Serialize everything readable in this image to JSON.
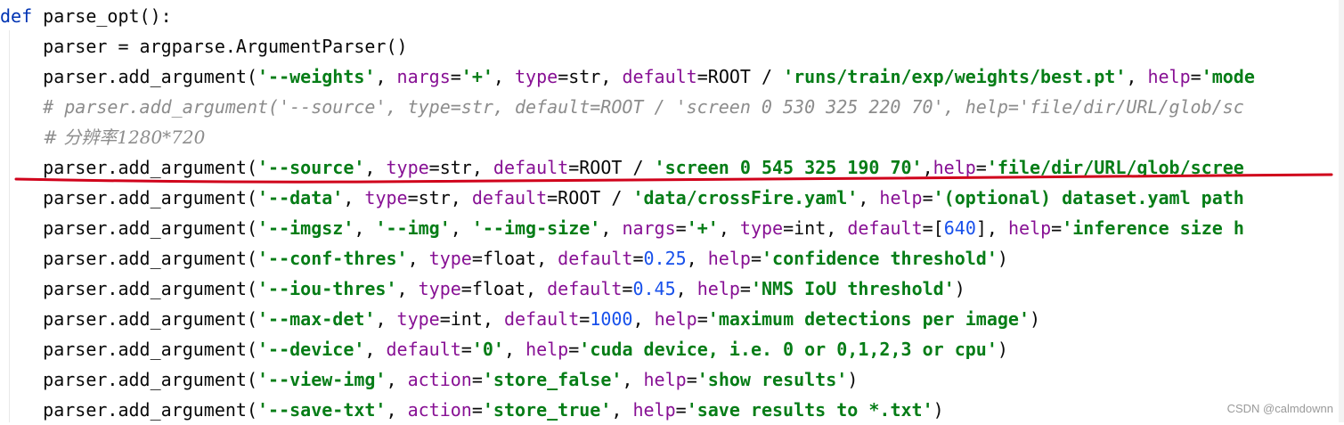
{
  "lines": [
    [
      {
        "t": "def",
        "c": "kw"
      },
      {
        "t": " parse_opt():"
      }
    ],
    [
      {
        "t": "    parser = argparse.ArgumentParser()"
      }
    ],
    [
      {
        "t": "    parser.add_argument("
      },
      {
        "t": "'--weights'",
        "c": "str"
      },
      {
        "t": ", "
      },
      {
        "t": "nargs",
        "c": "named"
      },
      {
        "t": "="
      },
      {
        "t": "'+'",
        "c": "str"
      },
      {
        "t": ", "
      },
      {
        "t": "type",
        "c": "named"
      },
      {
        "t": "=str, "
      },
      {
        "t": "default",
        "c": "named"
      },
      {
        "t": "=ROOT / "
      },
      {
        "t": "'runs/train/exp/weights/best.pt'",
        "c": "str"
      },
      {
        "t": ", "
      },
      {
        "t": "help",
        "c": "named"
      },
      {
        "t": "="
      },
      {
        "t": "'mode",
        "c": "str"
      }
    ],
    [
      {
        "t": "    "
      },
      {
        "t": "# parser.add_argument('--source', type=str, default=ROOT / 'screen 0 530 325 220 70', help='file/dir/URL/glob/sc",
        "c": "cmt"
      }
    ],
    [
      {
        "t": "    "
      },
      {
        "t": "# 分辨率1280*720",
        "c": "cmt"
      }
    ],
    [
      {
        "t": "    parser.add_argument("
      },
      {
        "t": "'--source'",
        "c": "str"
      },
      {
        "t": ", "
      },
      {
        "t": "type",
        "c": "named"
      },
      {
        "t": "=str, "
      },
      {
        "t": "default",
        "c": "named"
      },
      {
        "t": "=ROOT / "
      },
      {
        "t": "'screen 0 545 325 190 70'",
        "c": "str"
      },
      {
        "t": ","
      },
      {
        "t": "help",
        "c": "named"
      },
      {
        "t": "="
      },
      {
        "t": "'file/dir/URL/glob/scree",
        "c": "str"
      }
    ],
    [
      {
        "t": "    parser.add_argument("
      },
      {
        "t": "'--data'",
        "c": "str"
      },
      {
        "t": ", "
      },
      {
        "t": "type",
        "c": "named"
      },
      {
        "t": "=str, "
      },
      {
        "t": "default",
        "c": "named"
      },
      {
        "t": "=ROOT / "
      },
      {
        "t": "'data/crossFire.yaml'",
        "c": "str"
      },
      {
        "t": ", "
      },
      {
        "t": "help",
        "c": "named"
      },
      {
        "t": "="
      },
      {
        "t": "'(optional) dataset.yaml path",
        "c": "str"
      }
    ],
    [
      {
        "t": "    parser.add_argument("
      },
      {
        "t": "'--imgsz'",
        "c": "str"
      },
      {
        "t": ", "
      },
      {
        "t": "'--img'",
        "c": "str"
      },
      {
        "t": ", "
      },
      {
        "t": "'--img-size'",
        "c": "str"
      },
      {
        "t": ", "
      },
      {
        "t": "nargs",
        "c": "named"
      },
      {
        "t": "="
      },
      {
        "t": "'+'",
        "c": "str"
      },
      {
        "t": ", "
      },
      {
        "t": "type",
        "c": "named"
      },
      {
        "t": "=int, "
      },
      {
        "t": "default",
        "c": "named"
      },
      {
        "t": "=["
      },
      {
        "t": "640",
        "c": "num"
      },
      {
        "t": "], "
      },
      {
        "t": "help",
        "c": "named"
      },
      {
        "t": "="
      },
      {
        "t": "'inference size h",
        "c": "str"
      }
    ],
    [
      {
        "t": "    parser.add_argument("
      },
      {
        "t": "'--conf-thres'",
        "c": "str"
      },
      {
        "t": ", "
      },
      {
        "t": "type",
        "c": "named"
      },
      {
        "t": "=float, "
      },
      {
        "t": "default",
        "c": "named"
      },
      {
        "t": "="
      },
      {
        "t": "0.25",
        "c": "num"
      },
      {
        "t": ", "
      },
      {
        "t": "help",
        "c": "named"
      },
      {
        "t": "="
      },
      {
        "t": "'confidence threshold'",
        "c": "str"
      },
      {
        "t": ")"
      }
    ],
    [
      {
        "t": "    parser.add_argument("
      },
      {
        "t": "'--iou-thres'",
        "c": "str"
      },
      {
        "t": ", "
      },
      {
        "t": "type",
        "c": "named"
      },
      {
        "t": "=float, "
      },
      {
        "t": "default",
        "c": "named"
      },
      {
        "t": "="
      },
      {
        "t": "0.45",
        "c": "num"
      },
      {
        "t": ", "
      },
      {
        "t": "help",
        "c": "named"
      },
      {
        "t": "="
      },
      {
        "t": "'NMS IoU threshold'",
        "c": "str"
      },
      {
        "t": ")"
      }
    ],
    [
      {
        "t": "    parser.add_argument("
      },
      {
        "t": "'--max-det'",
        "c": "str"
      },
      {
        "t": ", "
      },
      {
        "t": "type",
        "c": "named"
      },
      {
        "t": "=int, "
      },
      {
        "t": "default",
        "c": "named"
      },
      {
        "t": "="
      },
      {
        "t": "1000",
        "c": "num"
      },
      {
        "t": ", "
      },
      {
        "t": "help",
        "c": "named"
      },
      {
        "t": "="
      },
      {
        "t": "'maximum detections per image'",
        "c": "str"
      },
      {
        "t": ")"
      }
    ],
    [
      {
        "t": "    parser.add_argument("
      },
      {
        "t": "'--device'",
        "c": "str"
      },
      {
        "t": ", "
      },
      {
        "t": "default",
        "c": "named"
      },
      {
        "t": "="
      },
      {
        "t": "'0'",
        "c": "str"
      },
      {
        "t": ", "
      },
      {
        "t": "help",
        "c": "named"
      },
      {
        "t": "="
      },
      {
        "t": "'cuda device, i.e. 0 or 0,1,2,3 or cpu'",
        "c": "str"
      },
      {
        "t": ")"
      }
    ],
    [
      {
        "t": "    parser.add_argument("
      },
      {
        "t": "'--view-img'",
        "c": "str"
      },
      {
        "t": ", "
      },
      {
        "t": "action",
        "c": "named"
      },
      {
        "t": "="
      },
      {
        "t": "'store_false'",
        "c": "str"
      },
      {
        "t": ", "
      },
      {
        "t": "help",
        "c": "named"
      },
      {
        "t": "="
      },
      {
        "t": "'show results'",
        "c": "str"
      },
      {
        "t": ")"
      }
    ],
    [
      {
        "t": "    parser.add_argument("
      },
      {
        "t": "'--save-txt'",
        "c": "str"
      },
      {
        "t": ", "
      },
      {
        "t": "action",
        "c": "named"
      },
      {
        "t": "="
      },
      {
        "t": "'store_true'",
        "c": "str"
      },
      {
        "t": ", "
      },
      {
        "t": "help",
        "c": "named"
      },
      {
        "t": "="
      },
      {
        "t": "'save results to *.txt'",
        "c": "str"
      },
      {
        "t": ")"
      }
    ]
  ],
  "highlight_color": "#d0021b",
  "watermark": "CSDN @calmdownn"
}
